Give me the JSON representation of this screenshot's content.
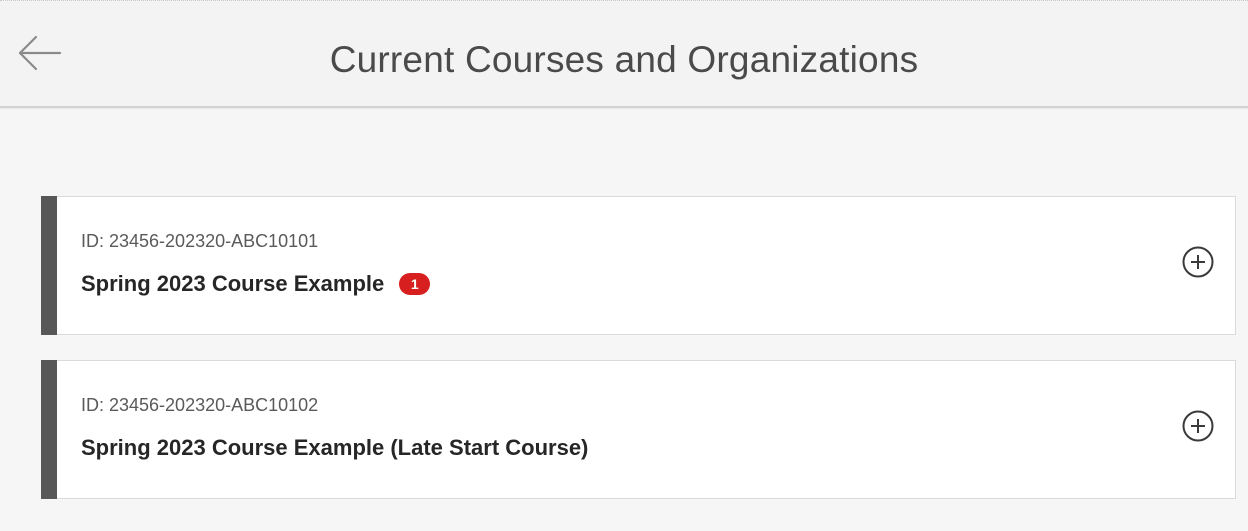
{
  "header": {
    "title": "Current Courses and Organizations",
    "back_icon": "arrow-left-icon"
  },
  "courses": [
    {
      "id_text": "ID: 23456-202320-ABC10101",
      "name": "Spring 2023 Course Example",
      "badge": "1",
      "expand_icon": "plus-circle-icon"
    },
    {
      "id_text": "ID: 23456-202320-ABC10102",
      "name": "Spring 2023 Course Example (Late Start Course)",
      "expand_icon": "plus-circle-icon"
    }
  ],
  "colors": {
    "accent_bar": "#575757",
    "badge": "#d71f1f",
    "background": "#f6f6f6"
  }
}
